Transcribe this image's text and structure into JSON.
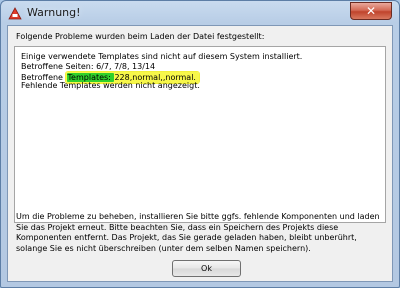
{
  "window": {
    "title": "Warnung!",
    "close_label": "✕"
  },
  "dialog": {
    "heading": "Folgende Probleme wurden beim Laden der Datei festgestellt:",
    "problems": {
      "line1": "Einige verwendete Templates sind nicht auf diesem System installiert.",
      "line2": "Betroffene Seiten: 6/7, 7/8, 13/14",
      "line3_prefix": "Betroffene ",
      "line3_templates": "Templates: ",
      "line3_value": "228,normal,,normal.",
      "line4": "Fehlende Templates werden nicht angezeigt."
    },
    "explanation": "Um die Probleme zu beheben, installieren Sie bitte ggfs. fehlende Komponenten und laden Sie das Projekt erneut. Bitte beachten Sie, dass ein Speichern des Projekts diese Komponenten entfernt. Das Projekt, das Sie gerade geladen haben, bleibt unberührt, solange Sie es nicht überschreiben (unter dem selben Namen speichern).",
    "ok_label": "Ok"
  }
}
